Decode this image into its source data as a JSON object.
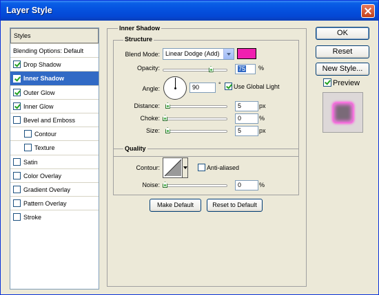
{
  "window": {
    "title": "Layer Style"
  },
  "styles_panel": {
    "header": "Styles",
    "items": [
      {
        "label": "Blending Options: Default",
        "checkbox": false,
        "checked": false,
        "selected": false,
        "indent": false
      },
      {
        "label": "Drop Shadow",
        "checkbox": true,
        "checked": true,
        "selected": false,
        "indent": false
      },
      {
        "label": "Inner Shadow",
        "checkbox": true,
        "checked": true,
        "selected": true,
        "indent": false
      },
      {
        "label": "Outer Glow",
        "checkbox": true,
        "checked": true,
        "selected": false,
        "indent": false
      },
      {
        "label": "Inner Glow",
        "checkbox": true,
        "checked": true,
        "selected": false,
        "indent": false
      },
      {
        "label": "Bevel and Emboss",
        "checkbox": true,
        "checked": false,
        "selected": false,
        "indent": false
      },
      {
        "label": "Contour",
        "checkbox": true,
        "checked": false,
        "selected": false,
        "indent": true
      },
      {
        "label": "Texture",
        "checkbox": true,
        "checked": false,
        "selected": false,
        "indent": true
      },
      {
        "label": "Satin",
        "checkbox": true,
        "checked": false,
        "selected": false,
        "indent": false
      },
      {
        "label": "Color Overlay",
        "checkbox": true,
        "checked": false,
        "selected": false,
        "indent": false
      },
      {
        "label": "Gradient Overlay",
        "checkbox": true,
        "checked": false,
        "selected": false,
        "indent": false
      },
      {
        "label": "Pattern Overlay",
        "checkbox": true,
        "checked": false,
        "selected": false,
        "indent": false
      },
      {
        "label": "Stroke",
        "checkbox": true,
        "checked": false,
        "selected": false,
        "indent": false
      }
    ]
  },
  "inner_shadow": {
    "title": "Inner Shadow",
    "structure": {
      "title": "Structure",
      "blend_mode_label": "Blend Mode:",
      "blend_mode_value": "Linear Dodge (Add)",
      "blend_color": "#f020b0",
      "opacity_label": "Opacity:",
      "opacity_value": "75",
      "opacity_unit": "%",
      "opacity_level": 0.75,
      "angle_label": "Angle:",
      "angle_value": "90",
      "angle_unit": "°",
      "use_global_light_label": "Use Global Light",
      "use_global_light": true,
      "distance_label": "Distance:",
      "distance_value": "5",
      "distance_unit": "px",
      "distance_level": 0.02,
      "choke_label": "Choke:",
      "choke_value": "0",
      "choke_unit": "%",
      "choke_level": 0.0,
      "size_label": "Size:",
      "size_value": "5",
      "size_unit": "px",
      "size_level": 0.02
    },
    "quality": {
      "title": "Quality",
      "contour_label": "Contour:",
      "anti_aliased_label": "Anti-aliased",
      "anti_aliased": false,
      "noise_label": "Noise:",
      "noise_value": "0",
      "noise_unit": "%",
      "noise_level": 0.0
    },
    "make_default_label": "Make Default",
    "reset_default_label": "Reset to Default"
  },
  "actions": {
    "ok_label": "OK",
    "reset_label": "Reset",
    "new_style_label": "New Style...",
    "preview_label": "Preview",
    "preview_checked": true
  },
  "colors": {
    "titlebar": "#0553e0",
    "selection": "#316ac5",
    "dialog_bg": "#ece9d8",
    "preview_glow": "#ff4fe0"
  }
}
